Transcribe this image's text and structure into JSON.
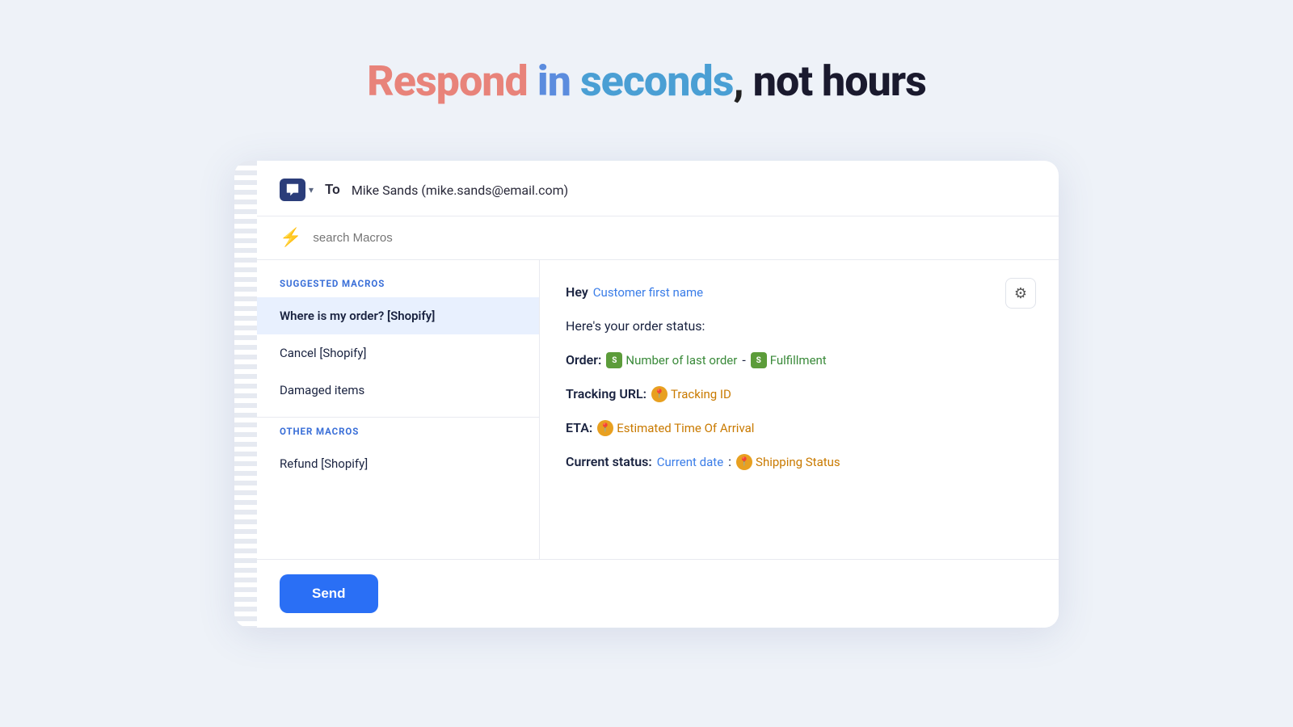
{
  "hero": {
    "respond": "Respond",
    "in": " in ",
    "seconds": "seconds",
    "comma": ",",
    "not_hours": " not hours"
  },
  "email_header": {
    "to_label": "To",
    "recipient": "Mike Sands (mike.sands@email.com)"
  },
  "search": {
    "placeholder": "search Macros"
  },
  "suggested_macros": {
    "section_label": "SUGGESTED MACROS",
    "items": [
      {
        "label": "Where is my order? [Shopify]",
        "selected": true
      },
      {
        "label": "Cancel [Shopify]",
        "selected": false
      },
      {
        "label": "Damaged items",
        "selected": false
      }
    ]
  },
  "other_macros": {
    "section_label": "OTHER MACROS",
    "items": [
      {
        "label": "Refund [Shopify]",
        "selected": false
      }
    ]
  },
  "message": {
    "greeting": "Hey",
    "customer_first_name": "Customer first name",
    "line2": "Here's your order status:",
    "order_label": "Order:",
    "number_of_last_order": "Number of last order",
    "dash": "-",
    "fulfillment": "Fulfillment",
    "tracking_label": "Tracking URL:",
    "tracking_id": "Tracking ID",
    "eta_label": "ETA:",
    "estimated_time": "Estimated Time Of Arrival",
    "status_label": "Current status:",
    "current_date": "Current date",
    "colon": ":",
    "shipping_status": "Shipping Status"
  },
  "footer": {
    "send_label": "Send"
  }
}
